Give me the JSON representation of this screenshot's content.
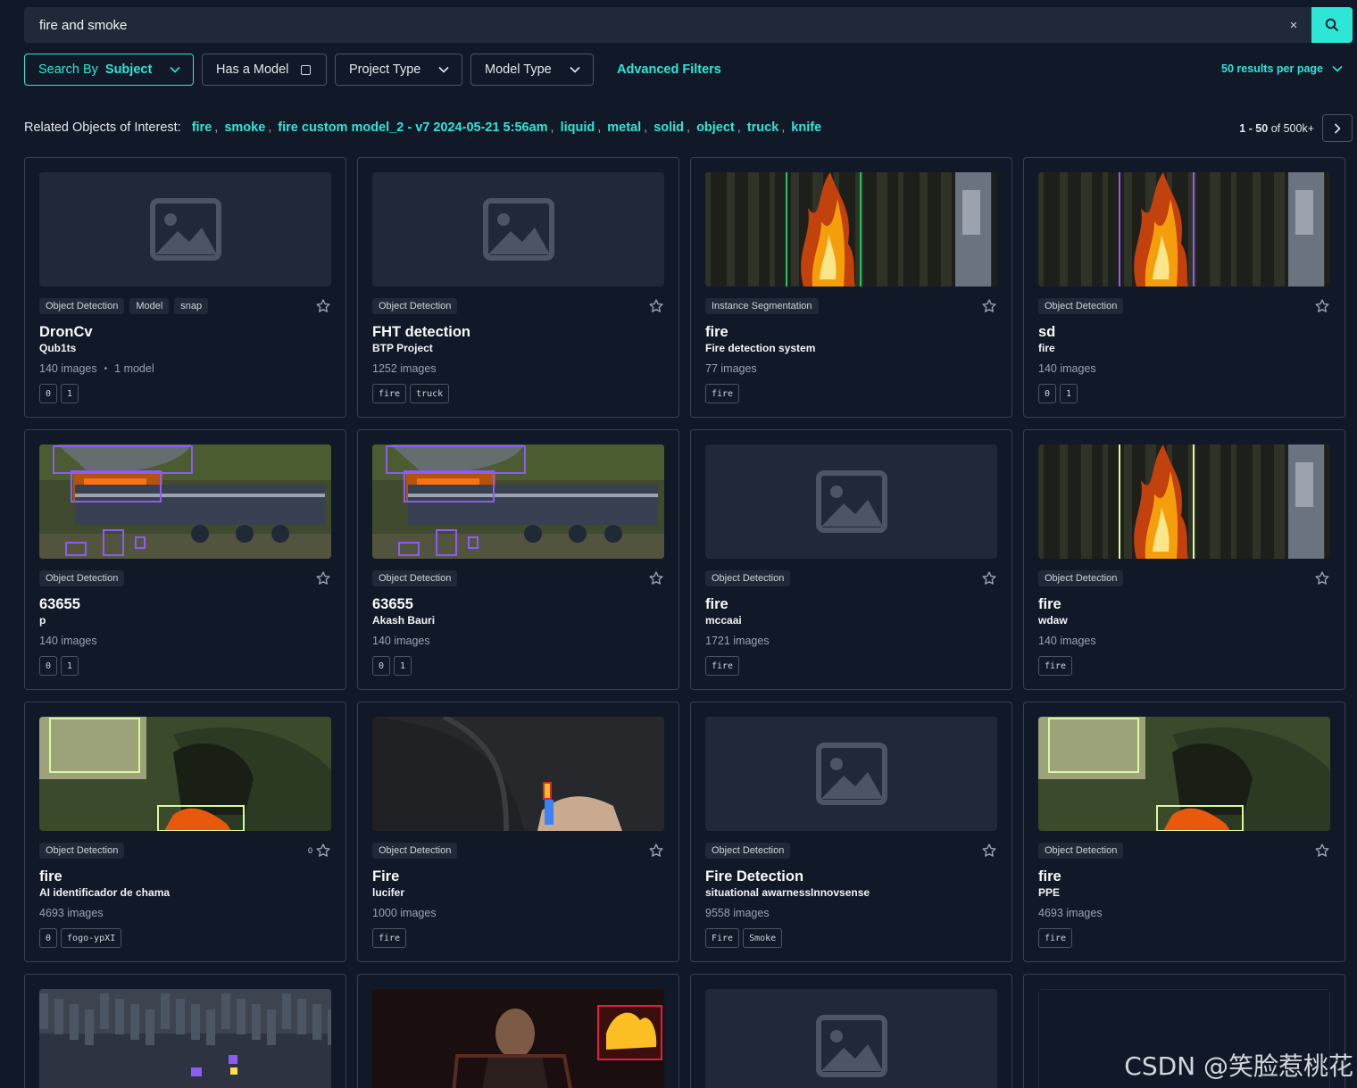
{
  "search": {
    "query": "fire and smoke",
    "clear_label": "×"
  },
  "filters": {
    "search_by_prefix": "Search By",
    "search_by_value": "Subject",
    "has_model": "Has a Model",
    "project_type": "Project Type",
    "model_type": "Model Type",
    "advanced": "Advanced Filters",
    "per_page": "50 results per page"
  },
  "related": {
    "label": "Related Objects of Interest:",
    "tags": [
      "fire",
      "smoke",
      "fire custom model_2 - v7 2024-05-21 5:56am",
      "liquid",
      "metal",
      "solid",
      "object",
      "truck",
      "knife"
    ]
  },
  "pagination": {
    "range": "1 - 50",
    "of": "of 500k+"
  },
  "colors": {
    "accent": "#2ee6d6",
    "background": "#111827",
    "card_border": "#374151"
  },
  "cards": [
    {
      "thumb": "placeholder",
      "badges": [
        "Object Detection",
        "Model",
        "snap"
      ],
      "title": "DronCv",
      "subtitle": "Qub1ts",
      "images": "140 images",
      "models": "1 model",
      "chips": [
        "0",
        "1"
      ],
      "stars": ""
    },
    {
      "thumb": "placeholder",
      "badges": [
        "Object Detection"
      ],
      "title": "FHT detection",
      "subtitle": "BTP Project",
      "images": "1252 images",
      "models": "",
      "chips": [
        "fire",
        "truck"
      ],
      "stars": ""
    },
    {
      "thumb": "forest-fire-green",
      "badges": [
        "Instance Segmentation"
      ],
      "title": "fire",
      "subtitle": "Fire detection system",
      "images": "77 images",
      "models": "",
      "chips": [
        "fire"
      ],
      "stars": ""
    },
    {
      "thumb": "forest-fire-purple",
      "badges": [
        "Object Detection"
      ],
      "title": "sd",
      "subtitle": "fire",
      "images": "140 images",
      "models": "",
      "chips": [
        "0",
        "1"
      ],
      "stars": ""
    },
    {
      "thumb": "truck-fire",
      "badges": [
        "Object Detection"
      ],
      "title": "63655",
      "subtitle": "p",
      "images": "140 images",
      "models": "",
      "chips": [
        "0",
        "1"
      ],
      "stars": ""
    },
    {
      "thumb": "truck-fire",
      "badges": [
        "Object Detection"
      ],
      "title": "63655",
      "subtitle": "Akash Bauri",
      "images": "140 images",
      "models": "",
      "chips": [
        "0",
        "1"
      ],
      "stars": ""
    },
    {
      "thumb": "placeholder",
      "badges": [
        "Object Detection"
      ],
      "title": "fire",
      "subtitle": "mccaai",
      "images": "1721 images",
      "models": "",
      "chips": [
        "fire"
      ],
      "stars": ""
    },
    {
      "thumb": "forest-fire-yellow",
      "badges": [
        "Object Detection"
      ],
      "title": "fire",
      "subtitle": "wdaw",
      "images": "140 images",
      "models": "",
      "chips": [
        "fire"
      ],
      "stars": ""
    },
    {
      "thumb": "campfire",
      "badges": [
        "Object Detection"
      ],
      "title": "fire",
      "subtitle": "AI identificador de chama",
      "images": "4693 images",
      "models": "",
      "chips": [
        "0",
        "fogo-ypXI"
      ],
      "stars": "0"
    },
    {
      "thumb": "lighter",
      "badges": [
        "Object Detection"
      ],
      "title": "Fire",
      "subtitle": "lucifer",
      "images": "1000 images",
      "models": "",
      "chips": [
        "fire"
      ],
      "stars": ""
    },
    {
      "thumb": "placeholder",
      "badges": [
        "Object Detection"
      ],
      "title": "Fire Detection",
      "subtitle": "situational awarnessInnovsense",
      "images": "9558 images",
      "models": "",
      "chips": [
        "Fire",
        "Smoke"
      ],
      "stars": ""
    },
    {
      "thumb": "campfire",
      "badges": [
        "Object Detection"
      ],
      "title": "fire",
      "subtitle": "PPE",
      "images": "4693 images",
      "models": "",
      "chips": [
        "fire"
      ],
      "stars": ""
    },
    {
      "thumb": "city-night",
      "partial": true
    },
    {
      "thumb": "person-fire",
      "partial": true
    },
    {
      "thumb": "placeholder",
      "partial": true
    },
    {
      "thumb": "blank",
      "partial": true
    }
  ],
  "watermark": "CSDN @笑脸惹桃花"
}
